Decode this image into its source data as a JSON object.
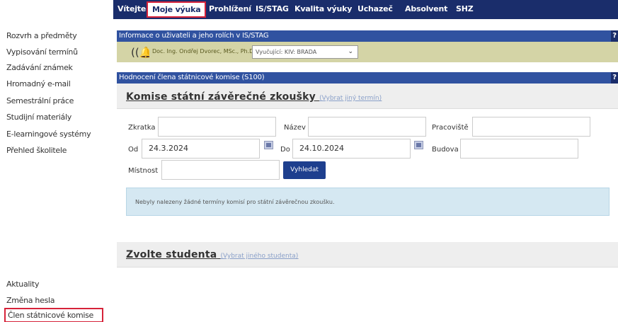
{
  "nav": {
    "items": [
      "Vítejte",
      "Moje výuka",
      "Prohlížení",
      "IS/STAG",
      "Kvalita výuky",
      "Uchazeč",
      "Absolvent",
      "SHZ"
    ]
  },
  "sidebar": {
    "items": [
      "Rozvrh a předměty",
      "Vypisování termínů",
      "Zadávání známek",
      "Hromadný e-mail",
      "Semestrální práce",
      "Studijní materiály",
      "E-learningové systémy",
      "Přehled školitele"
    ],
    "bottom_items": [
      "Aktuality",
      "Změna hesla",
      "Člen státnicové komise"
    ]
  },
  "user_panel": {
    "header": "Informace o uživateli a jeho rolích v IS/STAG",
    "help": "?",
    "user_name": "Doc. Ing. Ondřej Dvorec, MSc., Ph.D.,",
    "role_value": "Vyučující: KIV: BRADA"
  },
  "eval_panel": {
    "header": "Hodnocení člena státnicové komise (S100)",
    "help": "?"
  },
  "commission": {
    "title": "Komise státní závěrečné zkoušky",
    "link": "(Vybrat jiný termín)",
    "labels": {
      "abbr": "Zkratka",
      "name": "Název",
      "workplace": "Pracoviště",
      "from": "Od",
      "to": "Do",
      "building": "Budova",
      "room": "Místnost"
    },
    "values": {
      "abbr": "",
      "name": "",
      "workplace": "",
      "from": "24.3.2024",
      "to": "24.10.2024",
      "building": "",
      "room": ""
    },
    "search_label": "Vyhledat",
    "info_message": "Nebyly nalezeny žádné termíny komisí pro státní závěrečnou zkoušku."
  },
  "student": {
    "title": "Zvolte studenta",
    "link": "(Vybrat jiného studenta)"
  },
  "colors": {
    "nav_bg": "#1a2d6b",
    "panel_header_bg": "#3052a0",
    "highlight_border": "#d6233a",
    "user_bar_bg": "#d4d4a6",
    "info_box_bg": "#d5e8f2",
    "search_button_bg": "#1e3f8e"
  },
  "icons": {
    "bell": "bell-icon",
    "calendar": "calendar-icon",
    "help": "help-icon",
    "dropdown": "chevron-down-icon"
  }
}
